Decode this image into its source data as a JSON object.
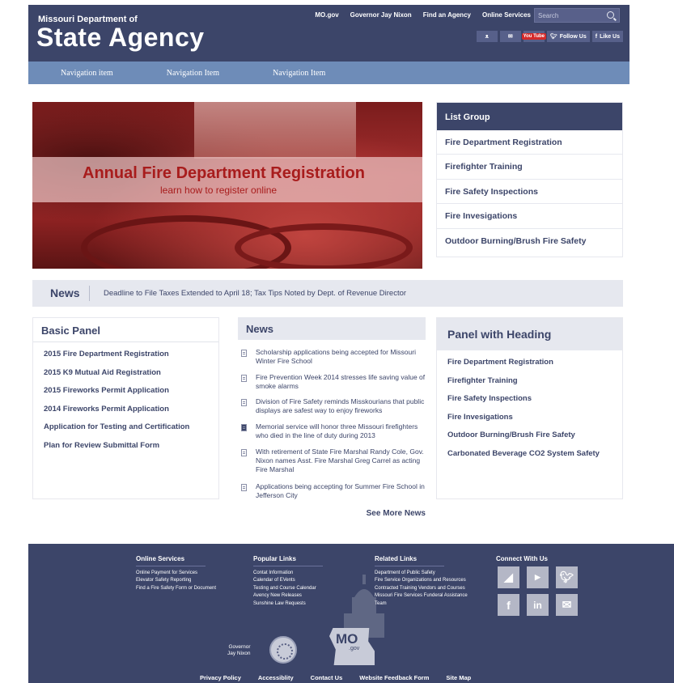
{
  "header": {
    "brand_small": "Missouri Department of",
    "brand_big": "State Agency",
    "top_links": [
      "MO.gov",
      "Governor Jay Nixon",
      "Find an Agency",
      "Online Services"
    ],
    "search_placeholder": "Search",
    "social": {
      "yt": "You Tube",
      "twitter": "Follow Us",
      "facebook": "Like Us"
    }
  },
  "nav": {
    "items": [
      "Navigation item",
      "Navigation Item",
      "Navigation Item"
    ]
  },
  "hero": {
    "title": "Annual Fire Department Registration",
    "subtitle": "learn how to register online"
  },
  "list_group": {
    "heading": "List Group",
    "items": [
      "Fire Department Registration",
      "Firefighter Training",
      "Fire Safety Inspections",
      "Fire Invesigations",
      "Outdoor Burning/Brush Fire Safety"
    ]
  },
  "ticker": {
    "label": "News",
    "text": "Deadline to File Taxes Extended to April 18; Tax Tips Noted by Dept. of Revenue Director"
  },
  "basic_panel": {
    "heading": "Basic Panel",
    "items": [
      "2015 Fire Department Registration",
      "2015 K9 Mutual Aid Registration",
      "2015 Fireworks Permit Application",
      "2014 Fireworks Permit Application",
      "Application for Testing and Certification",
      "Plan for Review Submittal Form"
    ]
  },
  "news": {
    "heading": "News",
    "items": [
      "Scholarship applications being accepted for Missouri Winter Fire School",
      "Fire Prevention Week 2014 stresses life saving value of smoke alarms",
      "Division of Fire Safety reminds Misskourians that public displays are safest way to enjoy fireworks",
      "Memorial service will honor three Missouri firefighters who died in the line of duty during 2013",
      "With retirement of State Fire Marshal Randy Cole, Gov. Nixon names Asst. Fire Marshal Greg Carrel as acting Fire Marshal",
      "Applications being accepting for Summer Fire School in Jefferson City"
    ],
    "see_more": "See More News"
  },
  "panel_heading": {
    "heading": "Panel with Heading",
    "items": [
      "Fire Department Registration",
      "Firefighter Training",
      "Fire Safety Inspections",
      "Fire Invesigations",
      "Outdoor Burning/Brush Fire Safety",
      "Carbonated Beverage CO2 System Safety"
    ]
  },
  "footer": {
    "online_services": {
      "title": "Online Services",
      "links": [
        "Online Payment for Services",
        "Elevator Safety Reporting",
        "Find a Fire Safety Form or Document"
      ]
    },
    "popular_links": {
      "title": "Popular Links",
      "links": [
        "Contat Information",
        "Calendar of EVents",
        "Testing and Course Calendar",
        "Avency New Releases",
        "Sunshine Law Requests"
      ]
    },
    "related_links": {
      "title": "Related Links",
      "links": [
        "Department of Public Safety",
        "Fire Service Organizations and Resources",
        "Contracted Training Vendors and Courses",
        "Missouri Fire Services Funderal Assistance",
        "Team"
      ]
    },
    "connect_title": "Connect With Us",
    "governor_label_1": "Governor",
    "governor_label_2": "Jay Nixon",
    "mo_label": "MO",
    "mo_gov": ".gov",
    "bottom_links": [
      "Privacy Policy",
      "Accessiblity",
      "Contact Us",
      "Website Feedback Form",
      "Site Map"
    ]
  },
  "colors": {
    "navy": "#3c4569",
    "nav_blue": "#6e8cb8",
    "hero_red": "#a81c1c",
    "panel_gray": "#e6e8ef"
  }
}
